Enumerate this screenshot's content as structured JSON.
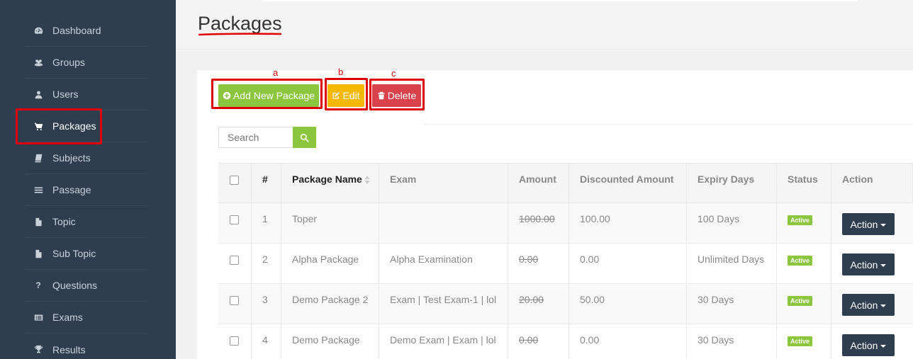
{
  "sidebar": {
    "items": [
      {
        "label": "Dashboard",
        "icon": "dashboard-icon"
      },
      {
        "label": "Groups",
        "icon": "users-group-icon"
      },
      {
        "label": "Users",
        "icon": "user-icon"
      },
      {
        "label": "Packages",
        "icon": "cart-icon",
        "active": true
      },
      {
        "label": "Subjects",
        "icon": "book-icon"
      },
      {
        "label": "Passage",
        "icon": "bars-icon"
      },
      {
        "label": "Topic",
        "icon": "file-icon"
      },
      {
        "label": "Sub Topic",
        "icon": "file-icon"
      },
      {
        "label": "Questions",
        "icon": "question-icon"
      },
      {
        "label": "Exams",
        "icon": "list-card-icon"
      },
      {
        "label": "Results",
        "icon": "trophy-icon"
      }
    ]
  },
  "header": {
    "title": "Packages"
  },
  "toolbar": {
    "add_label": "Add New Package",
    "edit_label": "Edit",
    "delete_label": "Delete",
    "annotations": {
      "a": "a",
      "b": "b",
      "c": "c"
    }
  },
  "search": {
    "placeholder": "Search"
  },
  "table": {
    "columns": [
      "#",
      "Package Name",
      "Exam",
      "Amount",
      "Discounted Amount",
      "Expiry Days",
      "Status",
      "Action"
    ],
    "rows": [
      {
        "num": "1",
        "name": "Toper",
        "exam": "",
        "amount": "1000.00",
        "discounted": "100.00",
        "expiry": "100 Days",
        "status": "Active",
        "action": "Action"
      },
      {
        "num": "2",
        "name": "Alpha Package",
        "exam": "Alpha Examination",
        "amount": "0.00",
        "discounted": "0.00",
        "expiry": "Unlimited Days",
        "status": "Active",
        "action": "Action"
      },
      {
        "num": "3",
        "name": "Demo Package 2",
        "exam": "Exam | Test Exam-1 | lol",
        "amount": "20.00",
        "discounted": "50.00",
        "expiry": "30 Days",
        "status": "Active",
        "action": "Action"
      },
      {
        "num": "4",
        "name": "Demo Package",
        "exam": "Demo Exam | Exam | lol",
        "amount": "0.00",
        "discounted": "0.00",
        "expiry": "30 Days",
        "status": "Active",
        "action": "Action"
      }
    ]
  },
  "colors": {
    "sidebar_bg": "#2e3e4f",
    "green": "#8cc63f",
    "yellow": "#f5b800",
    "red": "#d9414b",
    "annotation_red": "#e00000"
  }
}
